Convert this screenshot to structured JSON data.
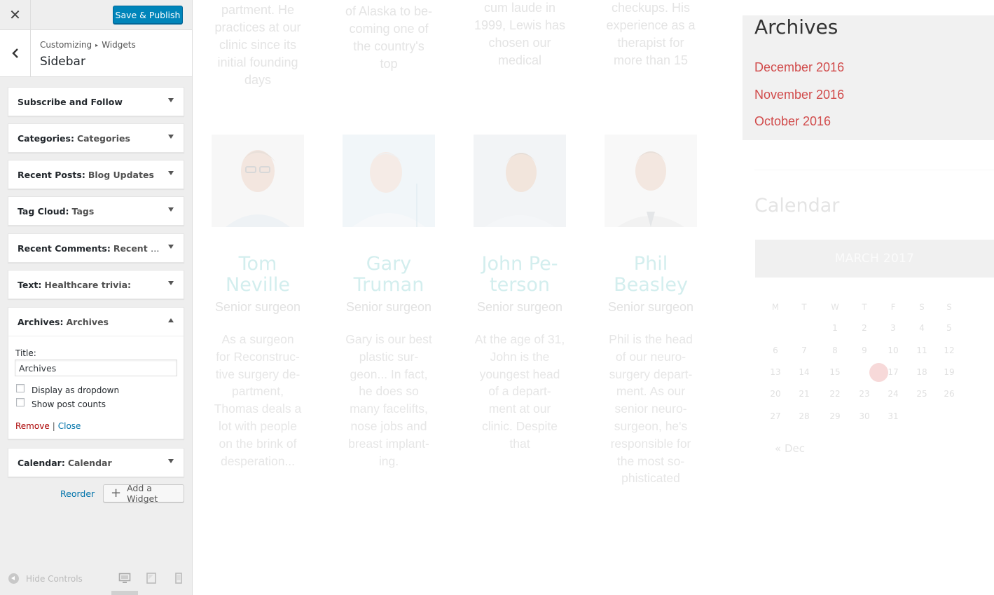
{
  "topbar": {
    "close_glyph": "✕",
    "publish_label": "Save & Publish"
  },
  "section": {
    "crumb_1": "Customizing",
    "crumb_sep": "▸",
    "crumb_2": "Widgets",
    "title": "Sidebar"
  },
  "widgets": [
    {
      "type": "Subscribe and Follow",
      "title": ""
    },
    {
      "type": "Categories:",
      "title": "Categories"
    },
    {
      "type": "Recent Posts:",
      "title": "Blog Updates"
    },
    {
      "type": "Tag Cloud:",
      "title": "Tags"
    },
    {
      "type": "Recent Comments:",
      "title": "Recent Com..."
    },
    {
      "type": "Text:",
      "title": "Healthcare trivia:"
    },
    {
      "type": "Archives:",
      "title": "Archives"
    },
    {
      "type": "Calendar:",
      "title": "Calendar"
    }
  ],
  "archives_form": {
    "title_label": "Title:",
    "title_value": "Archives",
    "dropdown_label": "Display as dropdown",
    "postcounts_label": "Show post counts",
    "remove_label": "Remove",
    "pipe": "|",
    "close_label": "Close"
  },
  "actions": {
    "reorder_label": "Reorder",
    "add_widget_label": "Add a Widget",
    "add_glyph": "+"
  },
  "footer": {
    "hide_controls_label": "Hide Controls"
  },
  "preview": {
    "doctors": [
      {
        "top_text": [
          "partment. He",
          "practices at our",
          "clinic since its",
          "initial founding",
          "days"
        ],
        "name": [
          "Tom",
          "Neville"
        ],
        "role": "Senior surgeon",
        "bio": [
          "As a surgeon",
          "for Reconstruc-",
          "tive surgery de-",
          "partment,",
          "Thomas deals a",
          "lot with people",
          "on the brink of",
          "desperation..."
        ]
      },
      {
        "top_text": [
          "of Alaska to be-",
          "coming one of",
          "the country's",
          "top"
        ],
        "name": [
          "Gary",
          "Truman"
        ],
        "role": "Senior surgeon",
        "bio": [
          "Gary is our best",
          "plastic sur-",
          "geon... In fact,",
          "he does so",
          "many facelifts,",
          "nose jobs and",
          "breast implant-",
          "ing."
        ]
      },
      {
        "top_text": [
          "cum laude in",
          "1999, Lewis has",
          "chosen our",
          "medical"
        ],
        "name": [
          "John Pe-",
          "terson"
        ],
        "role": "Senior surgeon",
        "bio": [
          "At the age of 31,",
          "John is the",
          "youngest head",
          "of a depart-",
          "ment at our",
          "clinic. Despite",
          "that"
        ]
      },
      {
        "top_text": [
          "checkups. His",
          "experience as a",
          "therapist  for",
          "more than 15"
        ],
        "name": [
          "Phil",
          "Beasley"
        ],
        "role": "Senior surgeon",
        "bio": [
          "Phil is the head",
          "of our neuro-",
          "surgery depart-",
          "ment. As our",
          "senior neuro-",
          "surgeon, he's",
          "responsible for",
          "the most so-",
          "phisticated"
        ]
      }
    ],
    "archives_title": "Archives",
    "archives": [
      "December 2016",
      "November 2016",
      "October 2016"
    ],
    "calendar_title": "Calendar",
    "calendar_month": "MARCH 2017",
    "weekdays": [
      "M",
      "T",
      "W",
      "T",
      "F",
      "S",
      "S"
    ],
    "weeks": [
      [
        "",
        "",
        "1",
        "2",
        "3",
        "4",
        "5"
      ],
      [
        "6",
        "7",
        "8",
        "9",
        "10",
        "11",
        "12"
      ],
      [
        "13",
        "14",
        "15",
        "16",
        "17",
        "18",
        "19"
      ],
      [
        "20",
        "21",
        "22",
        "23",
        "24",
        "25",
        "26"
      ],
      [
        "27",
        "28",
        "29",
        "30",
        "31",
        "",
        ""
      ]
    ],
    "today": "16",
    "prev_link": "« Dec"
  },
  "colors": {
    "publish_blue": "#0085ba",
    "link_blue": "#0073aa",
    "remove_red": "#aa0000",
    "archive_red": "#d14b4b",
    "name_teal": "#d3eeee"
  },
  "icons": [
    "close-icon",
    "back-chevron-icon",
    "dropdown-arrow-icon",
    "plus-icon",
    "hide-controls-icon",
    "desktop-icon",
    "tablet-icon",
    "mobile-icon"
  ]
}
